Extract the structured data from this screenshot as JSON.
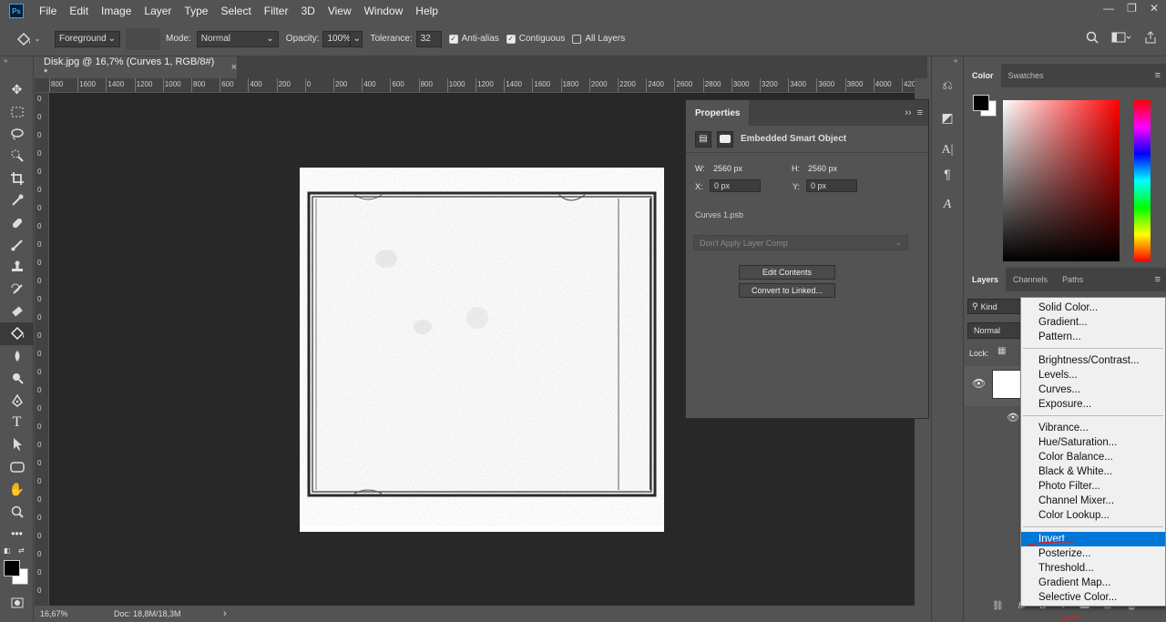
{
  "app": {
    "logo": "Ps",
    "menus": [
      "File",
      "Edit",
      "Image",
      "Layer",
      "Type",
      "Select",
      "Filter",
      "3D",
      "View",
      "Window",
      "Help"
    ],
    "window_controls": [
      "—",
      "❐",
      "✕"
    ]
  },
  "options_bar": {
    "fill_source": "Foreground",
    "mode_label": "Mode:",
    "mode_value": "Normal",
    "opacity_label": "Opacity:",
    "opacity_value": "100%",
    "tolerance_label": "Tolerance:",
    "tolerance_value": "32",
    "anti_alias": {
      "label": "Anti-alias",
      "checked": true
    },
    "contiguous": {
      "label": "Contiguous",
      "checked": true
    },
    "all_layers": {
      "label": "All Layers",
      "checked": false
    }
  },
  "document": {
    "tab_title": "Disk.jpg @ 16,7% (Curves 1, RGB/8#) *",
    "close": "×",
    "ruler_ticks": [
      "800",
      "1600",
      "1400",
      "1200",
      "1000",
      "800",
      "600",
      "400",
      "200",
      "0",
      "200",
      "400",
      "600",
      "800",
      "1000",
      "1200",
      "1400",
      "1600",
      "1800",
      "2000",
      "2200",
      "2400",
      "2600",
      "2800",
      "3000",
      "3200",
      "3400",
      "3600",
      "3800",
      "4000",
      "4200"
    ],
    "ruler_v_ticks": [
      "0",
      "0",
      "0",
      "0",
      "0",
      "0",
      "0",
      "0",
      "0",
      "0",
      "0",
      "0",
      "0",
      "0",
      "0",
      "0",
      "0",
      "0",
      "0",
      "0",
      "0",
      "0",
      "0",
      "0",
      "0",
      "0",
      "0",
      "0"
    ]
  },
  "status": {
    "zoom": "16,67%",
    "doc_info": "Doc: 18,8M/18,3M",
    "arrow": "›"
  },
  "properties": {
    "tab": "Properties",
    "kind": "Embedded Smart Object",
    "w_label": "W:",
    "w_value": "2560 px",
    "h_label": "H:",
    "h_value": "2560 px",
    "x_label": "X:",
    "x_value": "0 px",
    "y_label": "Y:",
    "y_value": "0 px",
    "file": "Curves 1.psb",
    "layer_comp": "Don't Apply Layer Comp",
    "btn_edit": "Edit Contents",
    "btn_convert": "Convert to Linked..."
  },
  "color_panel": {
    "tabs": [
      "Color",
      "Swatches"
    ]
  },
  "layers_panel": {
    "tabs": [
      "Layers",
      "Channels",
      "Paths"
    ],
    "filter": "Kind",
    "blend": "Normal",
    "lock": "Lock:"
  },
  "context_menu": {
    "groups": [
      [
        "Solid Color...",
        "Gradient...",
        "Pattern..."
      ],
      [
        "Brightness/Contrast...",
        "Levels...",
        "Curves...",
        "Exposure..."
      ],
      [
        "Vibrance...",
        "Hue/Saturation...",
        "Color Balance...",
        "Black & White...",
        "Photo Filter...",
        "Channel Mixer...",
        "Color Lookup..."
      ],
      [
        "Invert",
        "Posterize...",
        "Threshold...",
        "Gradient Map...",
        "Selective Color..."
      ]
    ],
    "highlighted": "Invert"
  },
  "colors": {
    "accent": "#0078d7",
    "annotation": "#e0201c"
  }
}
